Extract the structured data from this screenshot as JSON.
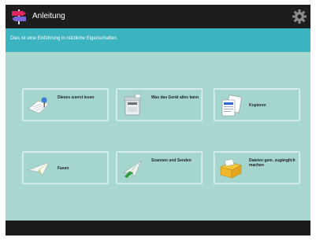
{
  "app": {
    "title": "Anleitung"
  },
  "info": {
    "text": "Dies ist eine Einführung in nützliche Eigenschaften."
  },
  "tiles": [
    {
      "label": "Dieses zuerst lesen",
      "icon": "paper-reading-icon"
    },
    {
      "label": "Was das Gerät alles kann",
      "icon": "printer-device-icon"
    },
    {
      "label": "Kopieren",
      "icon": "copy-documents-icon"
    },
    {
      "label": "Faxen",
      "icon": "fax-paper-plane-icon"
    },
    {
      "label": "Scannen und Senden",
      "icon": "scan-send-icon"
    },
    {
      "label": "Dateien gem. zugänglich machen",
      "icon": "shared-folder-icon"
    }
  ],
  "colors": {
    "titlebar": "#1d1d1d",
    "infobar": "#3cb4c0",
    "main": "#a8d8cf",
    "tile_bg": "#a4d6cd"
  }
}
